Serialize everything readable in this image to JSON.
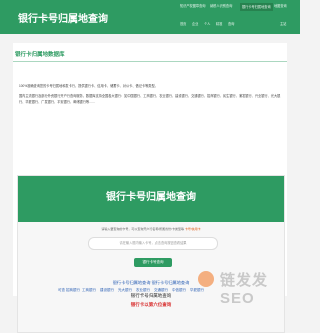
{
  "header": {
    "site_title": "银行卡号归属地查询",
    "nav": [
      {
        "label": "知识产权图章查询"
      },
      {
        "label": "纳税人识别查询"
      },
      {
        "label": "银行卡号归属地查询",
        "active": true
      },
      {
        "label": "地图查询"
      },
      {
        "label": "首页"
      },
      {
        "label": "企业"
      },
      {
        "label": "个人"
      },
      {
        "label": "精准"
      },
      {
        "label": "查询"
      },
      {
        "label": "主站"
      }
    ]
  },
  "content": {
    "section_title": "银行卡归属地数据库",
    "intro_paragraphs": [
      "100%准确查询您的卡号归属地和发卡行，提供银行卡、信用卡、储蓄卡、对公卡、借记卡等类型。",
      "国内主流银行及部分外资银行开户行查询服务，数据库支持全国各大银行：如中国银行、工商银行、农业银行、建设银行、交通银行、招商银行、民生银行、浦发银行、兴业银行、光大银行、华夏银行、广发银行、平安银行、邮储银行等……"
    ]
  },
  "tool": {
    "title": "银行卡号归属地查询",
    "sub_prefix": "请输入要查询的卡号，可以查询开户行名称/所属省份/卡类型等",
    "sub_highlight": "卡号/信用卡",
    "search_placeholder": "请在输入框内输入卡号，点击查询按钮查看结果",
    "query_button": "银行卡号查询",
    "links_line": "银行卡号归属地查询 银行卡号归属地查询",
    "line2": "银行卡号归属地查询",
    "line3": "银行卡以第六位查询"
  },
  "footer": {
    "items": [
      "可查 招商银行",
      "工商银行",
      "建设银行",
      "光大银行",
      "农业银行",
      "交通银行",
      "中信银行",
      "华夏银行"
    ]
  },
  "watermark": {
    "text": "链发发SEO"
  }
}
